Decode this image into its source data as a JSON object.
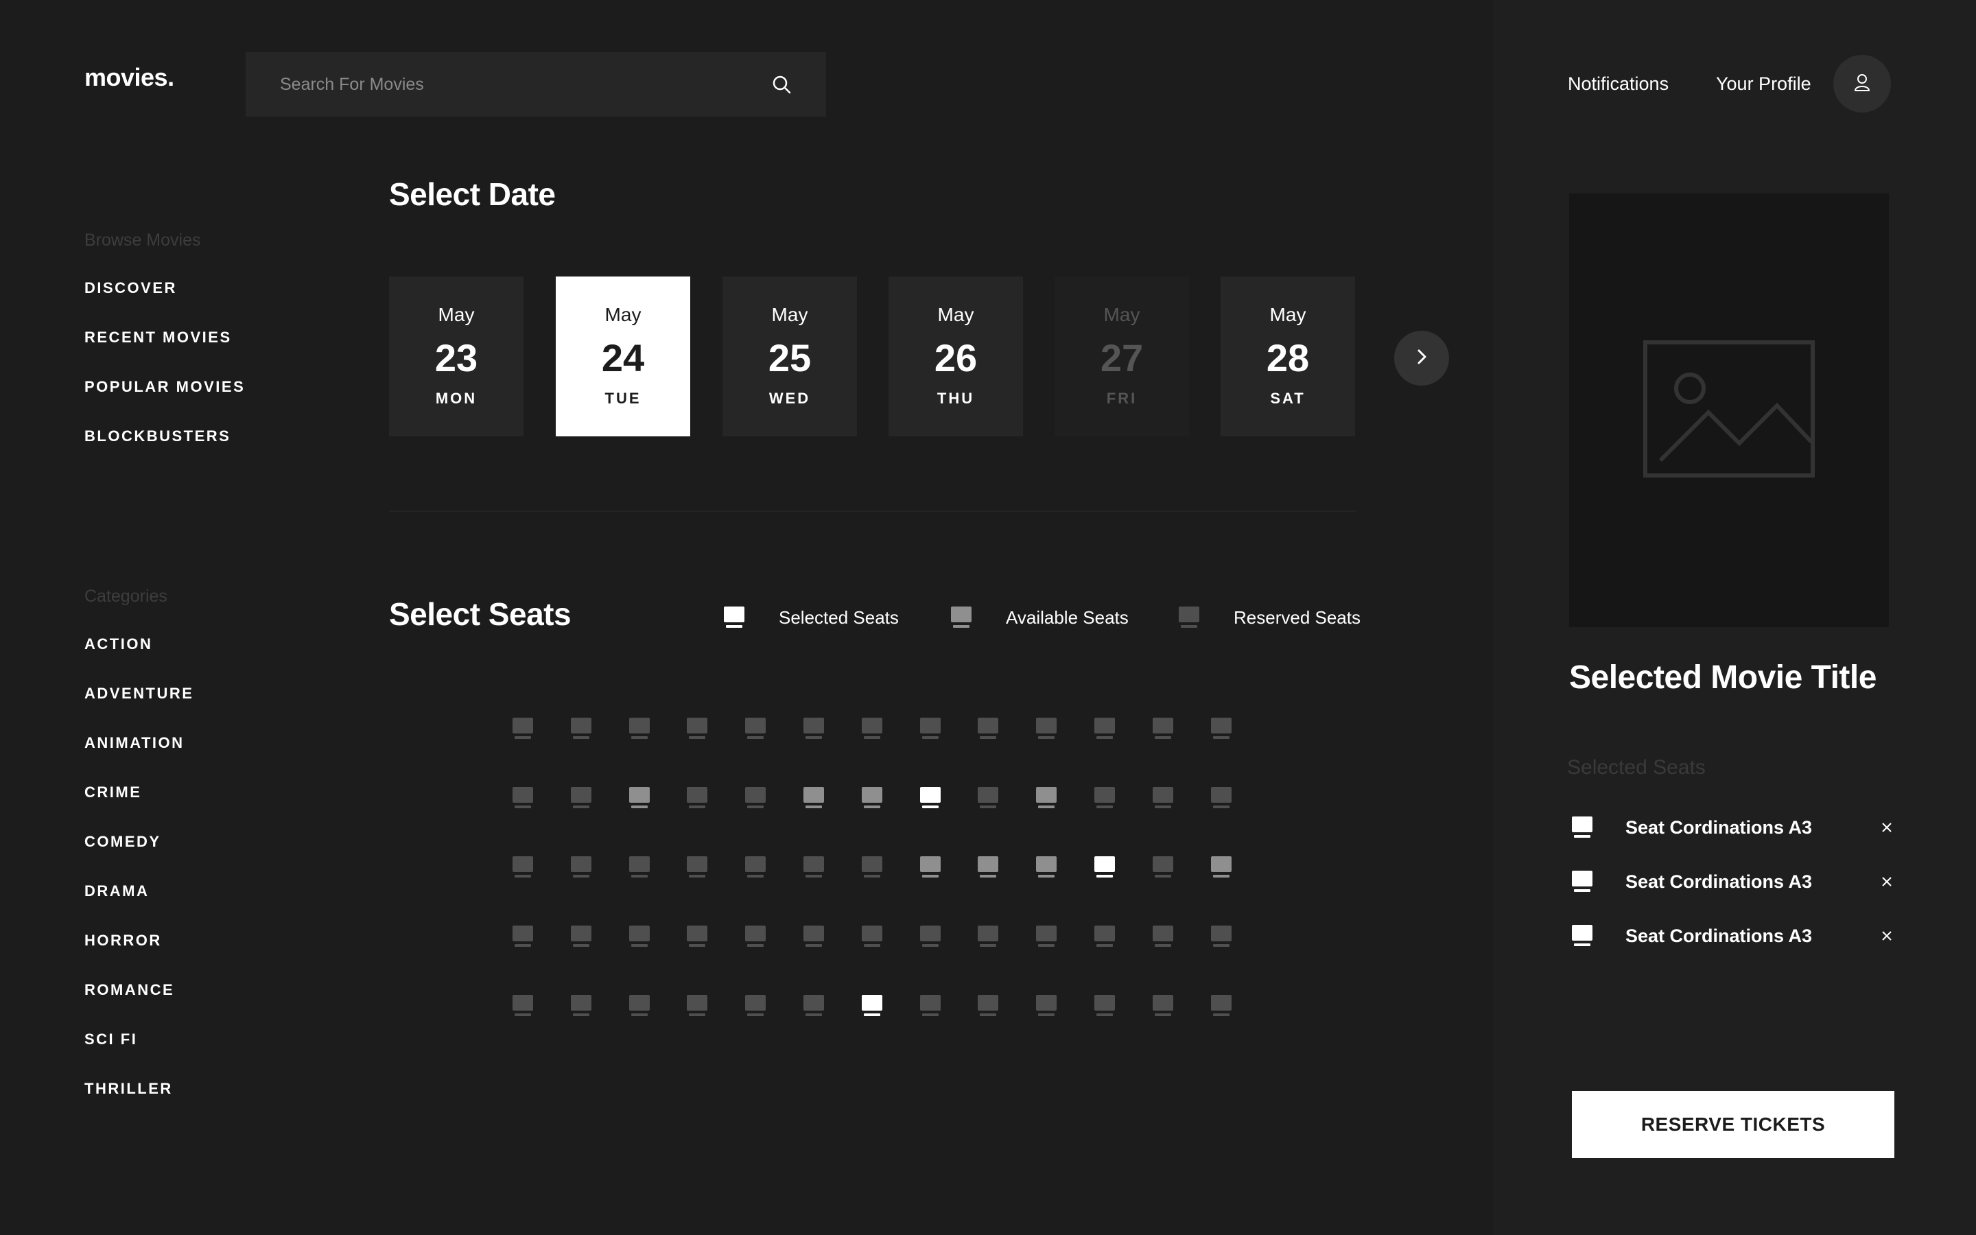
{
  "brand": {
    "logo": "movies."
  },
  "search": {
    "placeholder": "Search For Movies",
    "icon": "search-icon"
  },
  "sidebar": {
    "browse_title": "Browse Movies",
    "browse_items": [
      "DISCOVER",
      "RECENT MOVIES",
      "POPULAR MOVIES",
      "BLOCKBUSTERS"
    ],
    "categories_title": "Categories",
    "categories": [
      "ACTION",
      "ADVENTURE",
      "ANIMATION",
      "CRIME",
      "COMEDY",
      "DRAMA",
      "HORROR",
      "ROMANCE",
      "SCI FI",
      "THRILLER"
    ]
  },
  "dates_section": {
    "title": "Select Date",
    "dates": [
      {
        "month": "May",
        "day": "23",
        "weekday": "MON",
        "state": "normal"
      },
      {
        "month": "May",
        "day": "24",
        "weekday": "TUE",
        "state": "active"
      },
      {
        "month": "May",
        "day": "25",
        "weekday": "WED",
        "state": "normal"
      },
      {
        "month": "May",
        "day": "26",
        "weekday": "THU",
        "state": "normal"
      },
      {
        "month": "May",
        "day": "27",
        "weekday": "FRI",
        "state": "disabled"
      },
      {
        "month": "May",
        "day": "28",
        "weekday": "SAT",
        "state": "normal"
      }
    ],
    "next_icon": "chevron-right-icon"
  },
  "seats_section": {
    "title": "Select Seats",
    "legend": {
      "selected": "Selected Seats",
      "available": "Available Seats",
      "reserved": "Reserved Seats"
    },
    "rows": [
      [
        "r",
        "r",
        "r",
        "r",
        "r",
        "r",
        "r",
        "r",
        "r",
        "r",
        "r",
        "r",
        "r"
      ],
      [
        "r",
        "r",
        "a",
        "r",
        "r",
        "a",
        "a",
        "s",
        "r",
        "a",
        "r",
        "r",
        "r"
      ],
      [
        "r",
        "r",
        "r",
        "r",
        "r",
        "r",
        "r",
        "a",
        "a",
        "a",
        "s",
        "r",
        "a"
      ],
      [
        "r",
        "r",
        "r",
        "r",
        "r",
        "r",
        "r",
        "r",
        "r",
        "r",
        "r",
        "r",
        "r"
      ],
      [
        "r",
        "r",
        "r",
        "r",
        "r",
        "r",
        "s",
        "r",
        "r",
        "r",
        "r",
        "r",
        "r"
      ]
    ]
  },
  "topnav": {
    "notifications": "Notifications",
    "profile": "Your Profile",
    "avatar_icon": "user-icon"
  },
  "summary": {
    "poster_icon": "image-placeholder-icon",
    "movie_title": "Selected Movie Title",
    "selected_title": "Selected Seats",
    "selected_seats": [
      "Seat Cordinations A3",
      "Seat Cordinations A3",
      "Seat Cordinations A3"
    ],
    "reserve_label": "RESERVE TICKETS"
  },
  "colors": {
    "background": "#1c1c1c",
    "panel": "#1f1f1f",
    "card": "#262626",
    "accent": "#ffffff",
    "seat_available": "#8f8f8f",
    "seat_reserved": "#4f4f4f"
  }
}
